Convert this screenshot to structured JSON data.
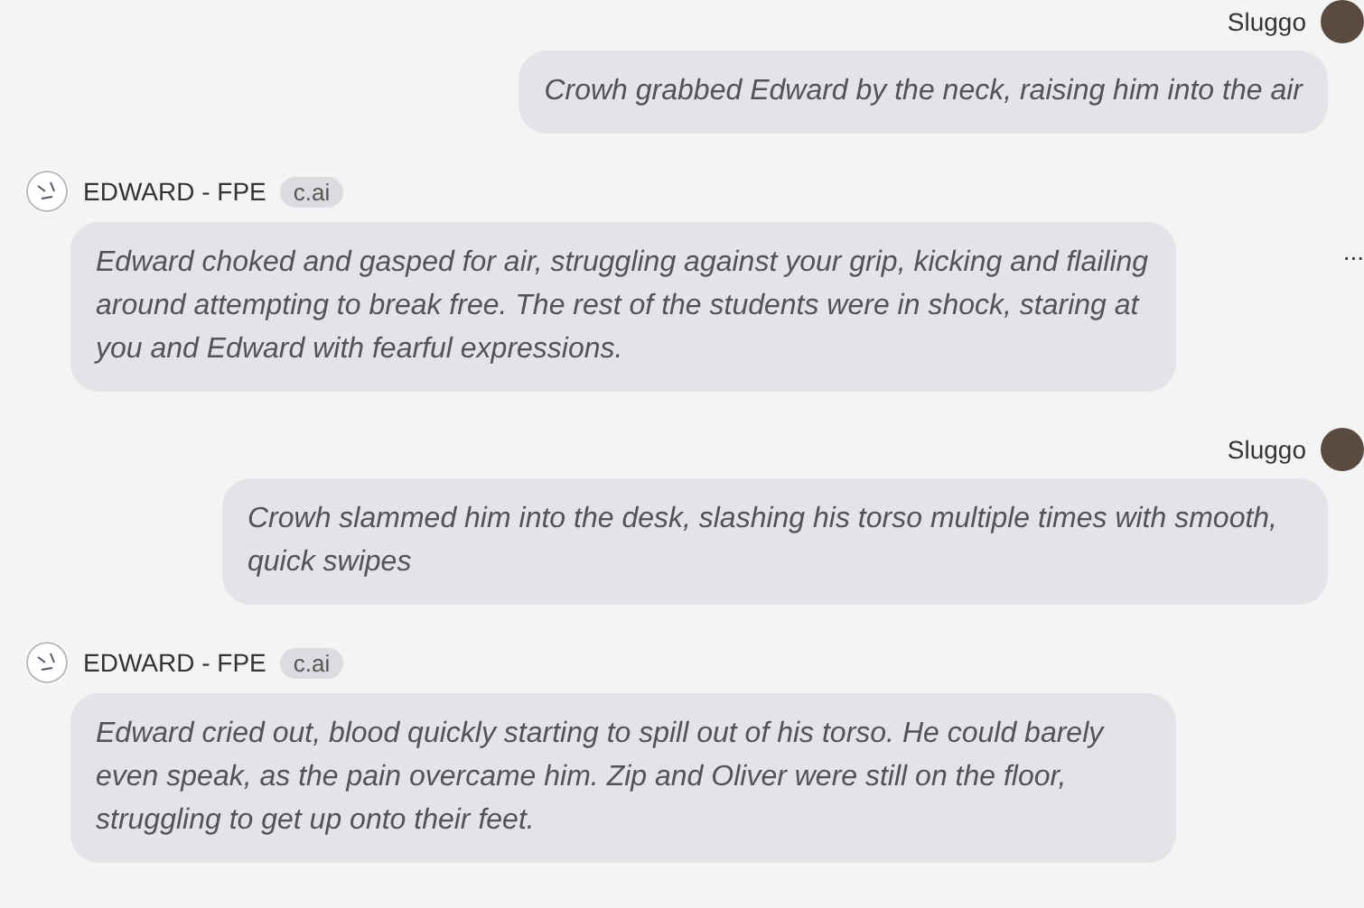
{
  "messages": [
    {
      "kind": "user",
      "name": "Sluggo",
      "text": "Crowh grabbed Edward by the neck, raising him into the air"
    },
    {
      "kind": "bot",
      "name": "EDWARD - FPE",
      "badge": "c.ai",
      "text": "Edward choked and gasped for air, struggling against your grip, kicking and flailing around attempting to break free. The rest of the students were in shock, staring at you and Edward with fearful expressions.",
      "menu": "..."
    },
    {
      "kind": "user",
      "name": "Sluggo",
      "text": "Crowh slammed him into the desk, slashing his torso multiple times with smooth, quick swipes"
    },
    {
      "kind": "bot",
      "name": "EDWARD - FPE",
      "badge": "c.ai",
      "text": "Edward cried out, blood quickly starting to spill out of his torso. He could barely even speak, as the pain overcame him. Zip and Oliver were still on the floor, struggling to get up onto their feet."
    }
  ]
}
